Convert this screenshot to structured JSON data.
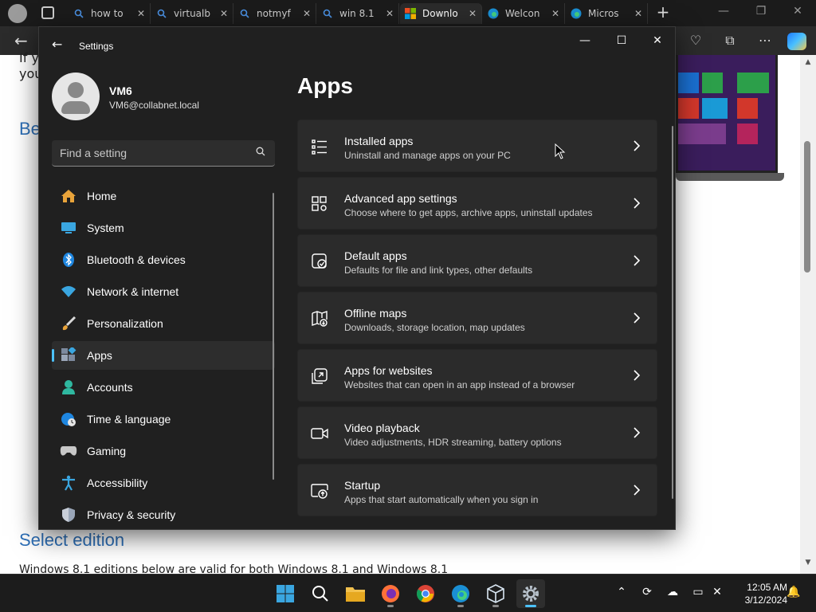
{
  "browser": {
    "tabs": [
      {
        "title": "how to",
        "icon": "search-icon",
        "active": false
      },
      {
        "title": "virtualb",
        "icon": "search-icon",
        "active": false
      },
      {
        "title": "notmyf",
        "icon": "search-icon",
        "active": false
      },
      {
        "title": "win 8.1",
        "icon": "search-icon",
        "active": false
      },
      {
        "title": "Downlo",
        "icon": "microsoft-logo-icon",
        "active": true
      },
      {
        "title": "Welcon",
        "icon": "edge-icon",
        "active": false
      },
      {
        "title": "Micros",
        "icon": "edge-icon",
        "active": false
      }
    ],
    "page": {
      "line1": "If y",
      "line2": "you",
      "heading_partial": "Be",
      "heading_select": "Select edition",
      "footer_text": "Windows 8.1 editions below are valid for both Windows 8.1 and Windows 8.1"
    }
  },
  "settings": {
    "window_title": "Settings",
    "user": {
      "name": "VM6",
      "email": "VM6@collabnet.local"
    },
    "search_placeholder": "Find a setting",
    "nav": [
      {
        "label": "Home",
        "icon": "home-icon",
        "selected": false
      },
      {
        "label": "System",
        "icon": "system-icon",
        "selected": false
      },
      {
        "label": "Bluetooth & devices",
        "icon": "bluetooth-icon",
        "selected": false
      },
      {
        "label": "Network & internet",
        "icon": "wifi-icon",
        "selected": false
      },
      {
        "label": "Personalization",
        "icon": "brush-icon",
        "selected": false
      },
      {
        "label": "Apps",
        "icon": "apps-icon",
        "selected": true
      },
      {
        "label": "Accounts",
        "icon": "accounts-icon",
        "selected": false
      },
      {
        "label": "Time & language",
        "icon": "globe-clock-icon",
        "selected": false
      },
      {
        "label": "Gaming",
        "icon": "gamepad-icon",
        "selected": false
      },
      {
        "label": "Accessibility",
        "icon": "accessibility-icon",
        "selected": false
      },
      {
        "label": "Privacy & security",
        "icon": "shield-icon",
        "selected": false
      }
    ],
    "page_title": "Apps",
    "cards": [
      {
        "title": "Installed apps",
        "subtitle": "Uninstall and manage apps on your PC",
        "icon": "installed-apps-icon"
      },
      {
        "title": "Advanced app settings",
        "subtitle": "Choose where to get apps, archive apps, uninstall updates",
        "icon": "advanced-app-settings-icon"
      },
      {
        "title": "Default apps",
        "subtitle": "Defaults for file and link types, other defaults",
        "icon": "default-apps-icon"
      },
      {
        "title": "Offline maps",
        "subtitle": "Downloads, storage location, map updates",
        "icon": "offline-maps-icon"
      },
      {
        "title": "Apps for websites",
        "subtitle": "Websites that can open in an app instead of a browser",
        "icon": "apps-for-websites-icon"
      },
      {
        "title": "Video playback",
        "subtitle": "Video adjustments, HDR streaming, battery options",
        "icon": "video-playback-icon"
      },
      {
        "title": "Startup",
        "subtitle": "Apps that start automatically when you sign in",
        "icon": "startup-icon"
      }
    ]
  },
  "taskbar": {
    "apps": [
      "start-icon",
      "search-icon",
      "file-explorer-icon",
      "firefox-icon",
      "chrome-icon",
      "edge-icon",
      "virtualbox-icon",
      "settings-icon"
    ],
    "time": "12:05 AM",
    "date": "3/12/2024"
  },
  "colors": {
    "accent": "#4cc2ff",
    "window_bg": "#202020",
    "card_bg": "#2b2b2b",
    "link_blue": "#2e70b8"
  }
}
